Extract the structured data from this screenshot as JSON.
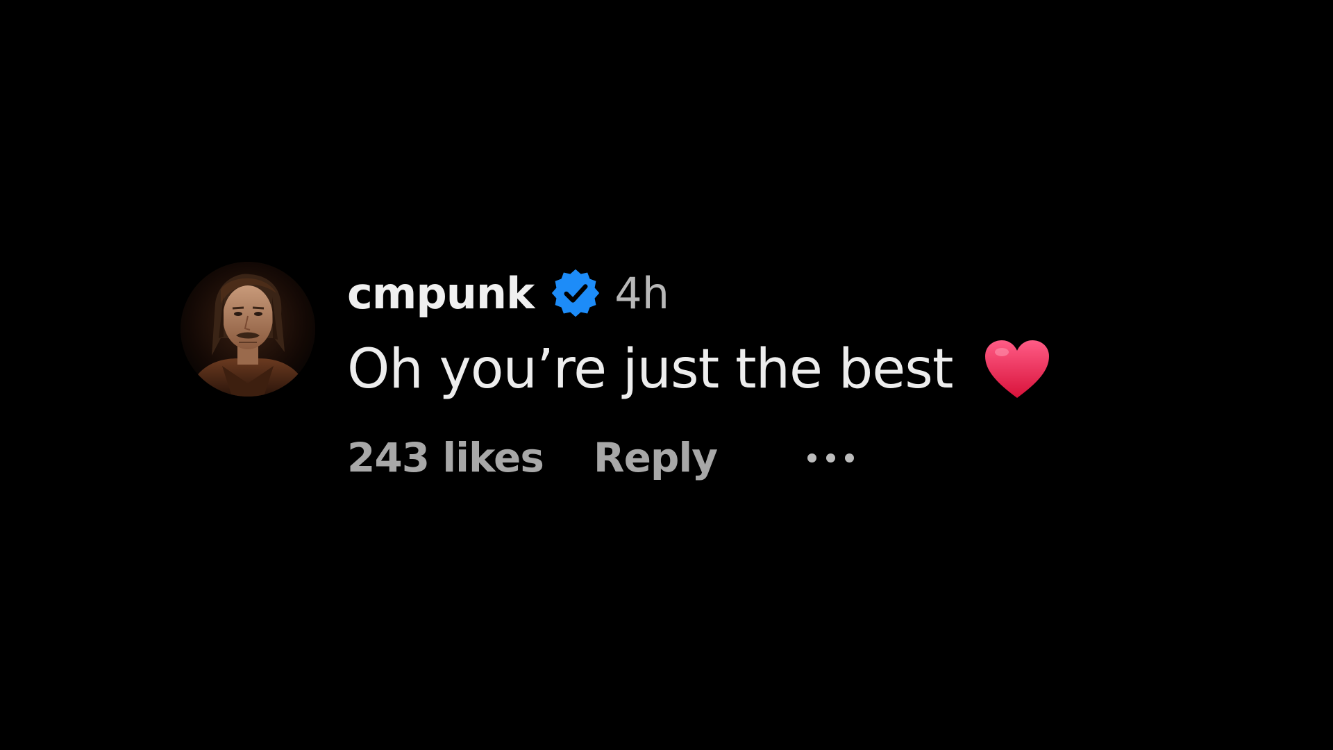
{
  "comment": {
    "username": "cmpunk",
    "verified": true,
    "timestamp": "4h",
    "text": "Oh you’re just the best",
    "emoji": "red-heart-icon",
    "likes_label": "243 likes",
    "reply_label": "Reply",
    "more_icon": "more-options-icon"
  },
  "colors": {
    "background": "#000000",
    "verified_badge": "#1d8cf8",
    "heart_top": "#ff4e7a",
    "heart_bottom": "#d8123a",
    "secondary_text": "#a8a8a8"
  }
}
